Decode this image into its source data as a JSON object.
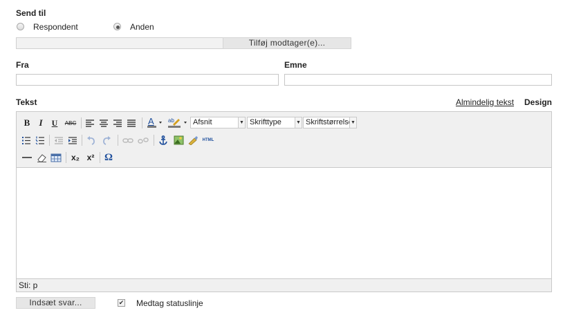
{
  "send_to": {
    "label": "Send til",
    "options": [
      {
        "label": "Respondent",
        "selected": false
      },
      {
        "label": "Anden",
        "selected": true
      }
    ],
    "recipient_value": "",
    "add_recipient_button": "Tilføj modtager(e)..."
  },
  "from": {
    "label": "Fra",
    "value": ""
  },
  "subject": {
    "label": "Emne",
    "value": ""
  },
  "text_section": {
    "label": "Tekst",
    "plain_text_link": "Almindelig tekst",
    "design_label": "Design"
  },
  "toolbar": {
    "bold": "B",
    "italic": "I",
    "underline": "U",
    "strikethrough": "ABC",
    "format_select": "Afsnit",
    "font_select": "Skrifttype",
    "size_select": "Skriftstørrelse",
    "html_label": "HTML",
    "subscript": "x₂",
    "superscript": "x²",
    "special_char": "Ω",
    "icons": [
      "align-left-icon",
      "align-center-icon",
      "align-right-icon",
      "align-justify-icon",
      "text-color-icon",
      "highlight-color-icon",
      "bullet-list-icon",
      "numbered-list-icon",
      "outdent-icon",
      "indent-icon",
      "undo-icon",
      "redo-icon",
      "link-icon",
      "unlink-icon",
      "anchor-icon",
      "image-icon",
      "cleanup-icon",
      "horizontal-rule-icon",
      "eraser-icon",
      "table-icon"
    ]
  },
  "editor": {
    "content": "",
    "path_label": "Sti: p"
  },
  "footer": {
    "insert_answer_button": "Indsæt svar...",
    "include_status_label": "Medtag statuslinje",
    "include_status_checked": true
  }
}
